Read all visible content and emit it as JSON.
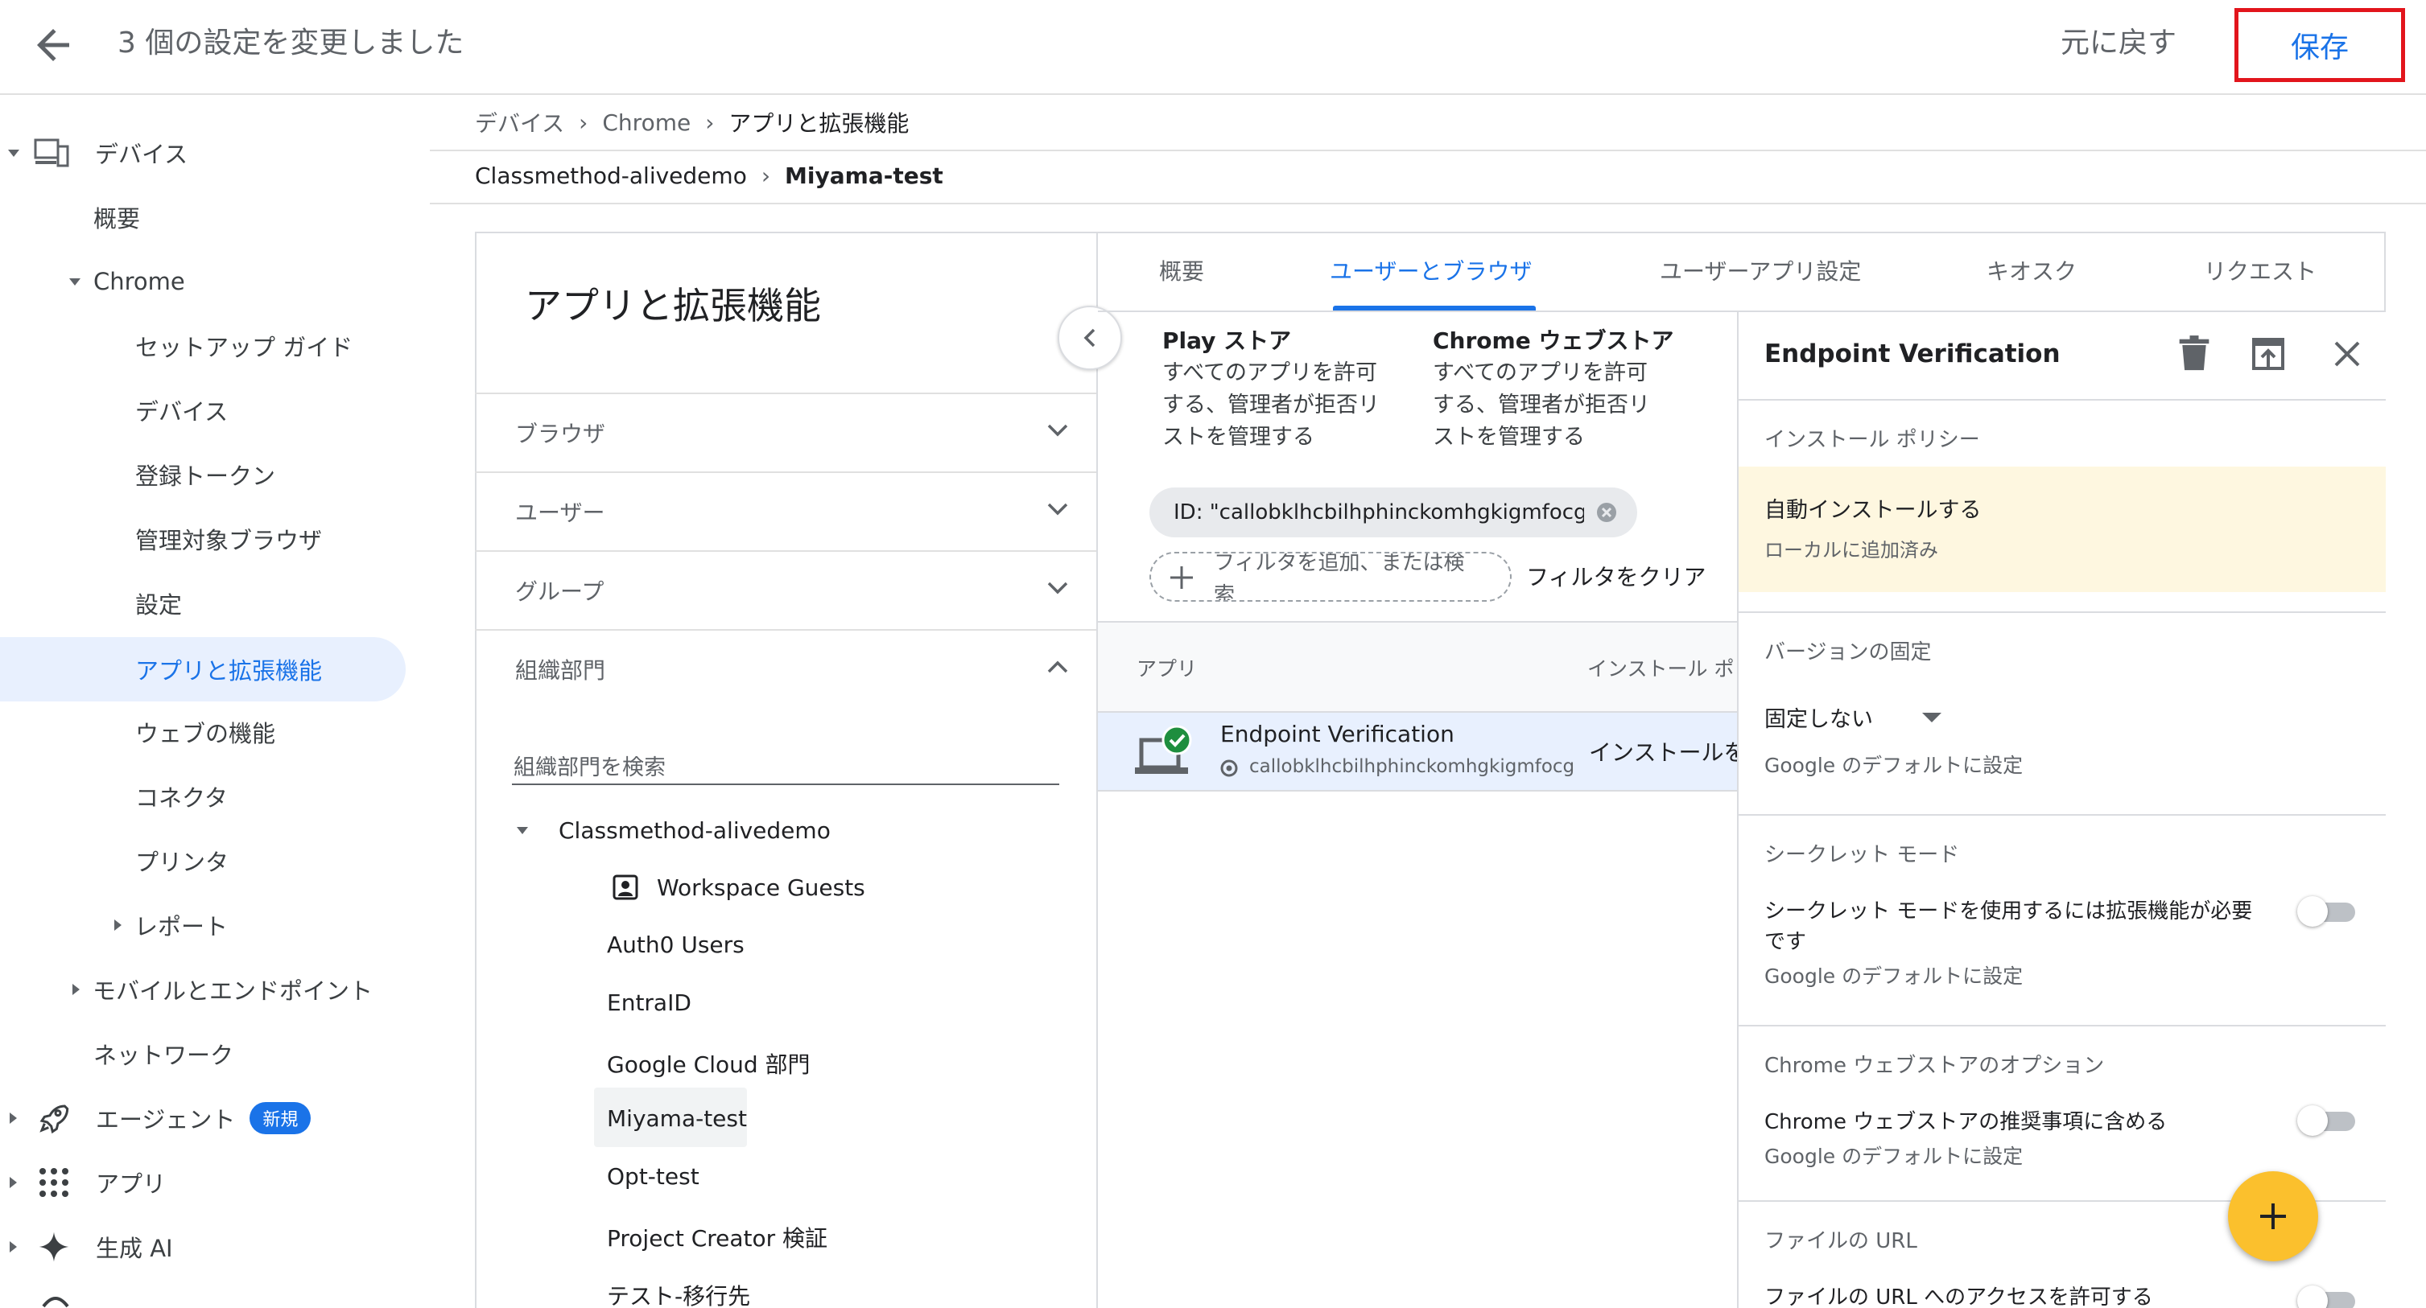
{
  "topbar": {
    "title": "3 個の設定を変更しました",
    "undo_label": "元に戻す",
    "save_label": "保存"
  },
  "nav": {
    "devices": "デバイス",
    "overview": "概要",
    "chrome": "Chrome",
    "setup_guide": "セットアップ ガイド",
    "chrome_devices": "デバイス",
    "enrollment_tokens": "登録トークン",
    "managed_browsers": "管理対象ブラウザ",
    "settings": "設定",
    "apps_extensions": "アプリと拡張機能",
    "web_features": "ウェブの機能",
    "connectors": "コネクタ",
    "printers": "プリンタ",
    "reports": "レポート",
    "mobile_endpoints": "モバイルとエンドポイント",
    "network": "ネットワーク",
    "agents": "エージェント",
    "agents_badge": "新規",
    "apps": "アプリ",
    "generative_ai": "生成 AI"
  },
  "breadcrumb": {
    "items": [
      "デバイス",
      "Chrome",
      "アプリと拡張機能"
    ]
  },
  "ou_breadcrumb": {
    "items": [
      "Classmethod-alivedemo",
      "Miyama-test"
    ]
  },
  "left_panel": {
    "title": "アプリと拡張機能",
    "sections": [
      "ブラウザ",
      "ユーザー",
      "グループ",
      "組織部門"
    ],
    "search_placeholder": "組織部門を検索",
    "root_ou": "Classmethod-alivedemo",
    "ous": [
      "Workspace Guests",
      "Auth0 Users",
      "EntraID",
      "Google Cloud 部門",
      "Miyama-test",
      "Opt-test",
      "Project Creator 検証",
      "テスト-移行先"
    ]
  },
  "tabs": [
    "概要",
    "ユーザーとブラウザ",
    "ユーザーアプリ設定",
    "キオスク",
    "リクエスト"
  ],
  "stores": {
    "play_title": "Play ストア",
    "play_lines": [
      "すべてのアプリを許可",
      "する、管理者が拒否リ",
      "ストを管理する"
    ],
    "webstore_title": "Chrome ウェブストア",
    "webstore_lines": [
      "すべてのアプリを許可",
      "する、管理者が拒否リ",
      "ストを管理する"
    ]
  },
  "filter": {
    "chip": "ID: \"callobklhcbilhphinckomhgkigmfocg\"",
    "add_line1": "フィルタを追加、または検",
    "add_line2": "索",
    "clear": "フィルタをクリア"
  },
  "table": {
    "col_app": "アプリ",
    "col_policy": "インストール ポリ",
    "row": {
      "name": "Endpoint Verification",
      "id": "callobklhcbilhphinckomhgkigmfocg",
      "policy": "インストールを"
    }
  },
  "detail": {
    "title": "Endpoint Verification",
    "install_policy_label": "インストール ポリシー",
    "install_policy_value": "自動インストールする",
    "install_policy_sub": "ローカルに追加済み",
    "version_label": "バージョンの固定",
    "version_value": "固定しない",
    "version_sub": "Google のデフォルトに設定",
    "incognito_label": "シークレット モード",
    "incognito_line1": "シークレット モードを使用するには拡張機能が必要",
    "incognito_line2": "です",
    "incognito_sub": "Google のデフォルトに設定",
    "webstore_opt_label": "Chrome ウェブストアのオプション",
    "webstore_opt_value": "Chrome ウェブストアの推奨事項に含める",
    "webstore_opt_sub": "Google のデフォルトに設定",
    "file_url_label": "ファイルの URL",
    "file_url_value": "ファイルの URL へのアクセスを許可する"
  },
  "colors": {
    "accent": "#1a73e8",
    "save_outline": "#e2151c",
    "fab": "#fbc02d",
    "policy_highlight": "#fef7e0",
    "selected_nav": "#e8f0fe",
    "selected_row": "#e8f0fe"
  }
}
